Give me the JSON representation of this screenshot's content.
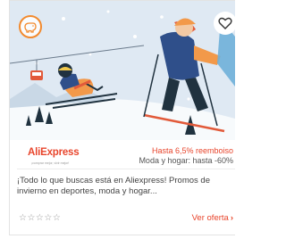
{
  "card": {
    "brand_logo": "AliExpress",
    "brand_tagline": "¡comprar mejor, vivir mejor!",
    "cashback_main": "Hasta 6,5% reemboiso",
    "cashback_sub": "Moda y hogar: hasta -60%",
    "description": "¡Todo lo que buscas está en Aliexpress! Promos de invierno en deportes, moda y hogar...",
    "rating_stars": "☆☆☆☆☆",
    "cta_label": "Ver oferta",
    "cta_icon": "chevron-right-icon",
    "badge_icon": "piggy-bank-icon",
    "favorite_icon": "heart-icon"
  },
  "colors": {
    "accent": "#e8452c",
    "badge_orange": "#f28a2e",
    "sky": "#dfe9f3"
  }
}
